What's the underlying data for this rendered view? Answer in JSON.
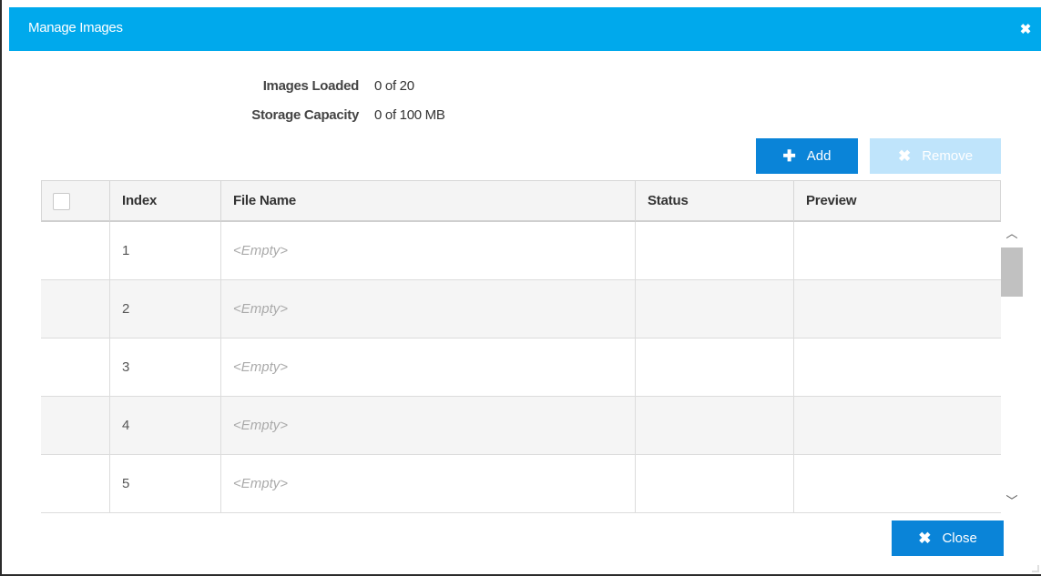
{
  "dialog": {
    "title": "Manage Images",
    "close_icon": "close-icon"
  },
  "summary": {
    "images_loaded_label": "Images Loaded",
    "images_loaded_value": "0 of 20",
    "storage_label": "Storage Capacity",
    "storage_value": "0 of 100 MB"
  },
  "toolbar": {
    "add_label": "Add",
    "add_icon": "plus-icon",
    "remove_label": "Remove",
    "remove_icon": "close-icon"
  },
  "table": {
    "columns": [
      "Index",
      "File Name",
      "Status",
      "Preview"
    ],
    "rows": [
      {
        "index": "1",
        "file_name": "<Empty>",
        "status": "",
        "preview": ""
      },
      {
        "index": "2",
        "file_name": "<Empty>",
        "status": "",
        "preview": ""
      },
      {
        "index": "3",
        "file_name": "<Empty>",
        "status": "",
        "preview": ""
      },
      {
        "index": "4",
        "file_name": "<Empty>",
        "status": "",
        "preview": ""
      },
      {
        "index": "5",
        "file_name": "<Empty>",
        "status": "",
        "preview": ""
      }
    ]
  },
  "footer": {
    "close_label": "Close",
    "close_icon": "close-icon"
  },
  "colors": {
    "titlebar": "#00a9ec",
    "primary_button": "#0a84d8",
    "disabled_button": "#bfe4fb"
  }
}
